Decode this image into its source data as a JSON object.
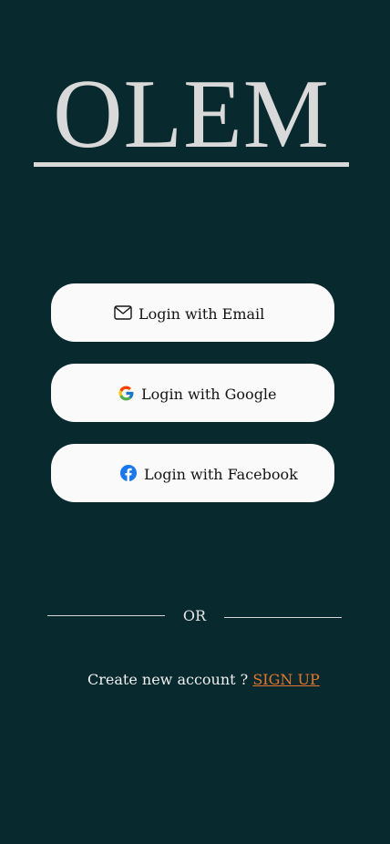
{
  "logo": {
    "text": "OLEM"
  },
  "login_buttons": {
    "email": {
      "label": "Login with Email",
      "icon": "mail-icon"
    },
    "google": {
      "label": "Login with Google",
      "icon": "google-icon"
    },
    "facebook": {
      "label": "Login with Facebook",
      "icon": "facebook-icon"
    }
  },
  "divider": {
    "label": "OR"
  },
  "signup": {
    "prompt": "Create new account ?",
    "link_label": "SIGN UP"
  },
  "colors": {
    "background": "#08292e",
    "button_background": "#fafafa",
    "accent": "#e8772e",
    "logo": "#d9d9d9",
    "facebook_blue": "#1877f2"
  }
}
